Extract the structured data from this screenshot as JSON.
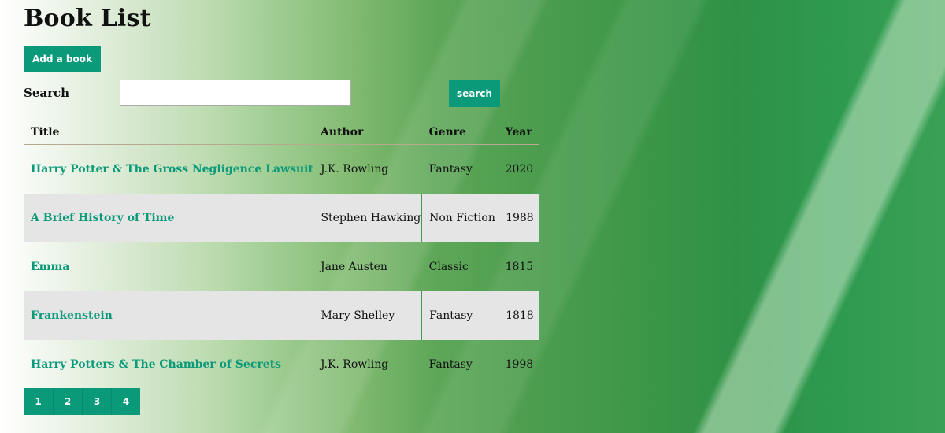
{
  "page_title": "Book List",
  "add_button_label": "Add a book",
  "search": {
    "label": "Search",
    "value": "",
    "placeholder": "",
    "button_label": "search"
  },
  "table": {
    "headers": {
      "title": "Title",
      "author": "Author",
      "genre": "Genre",
      "year": "Year"
    },
    "rows": [
      {
        "title": "Harry Potter & The Gross Negligence Lawsuit",
        "author": "J.K. Rowling",
        "genre": "Fantasy",
        "year": "2020"
      },
      {
        "title": "A Brief History of Time",
        "author": "Stephen Hawking",
        "genre": "Non Fiction",
        "year": "1988"
      },
      {
        "title": "Emma",
        "author": "Jane Austen",
        "genre": "Classic",
        "year": "1815"
      },
      {
        "title": "Frankenstein",
        "author": "Mary Shelley",
        "genre": "Fantasy",
        "year": "1818"
      },
      {
        "title": "Harry Potters & The Chamber of Secrets",
        "author": "J.K. Rowling",
        "genre": "Fantasy",
        "year": "1998"
      }
    ]
  },
  "pagination": [
    "1",
    "2",
    "3",
    "4"
  ],
  "colors": {
    "accent": "#0a9a7a",
    "row_shade": "#e5e5e5",
    "background_green": "#3f9848"
  }
}
